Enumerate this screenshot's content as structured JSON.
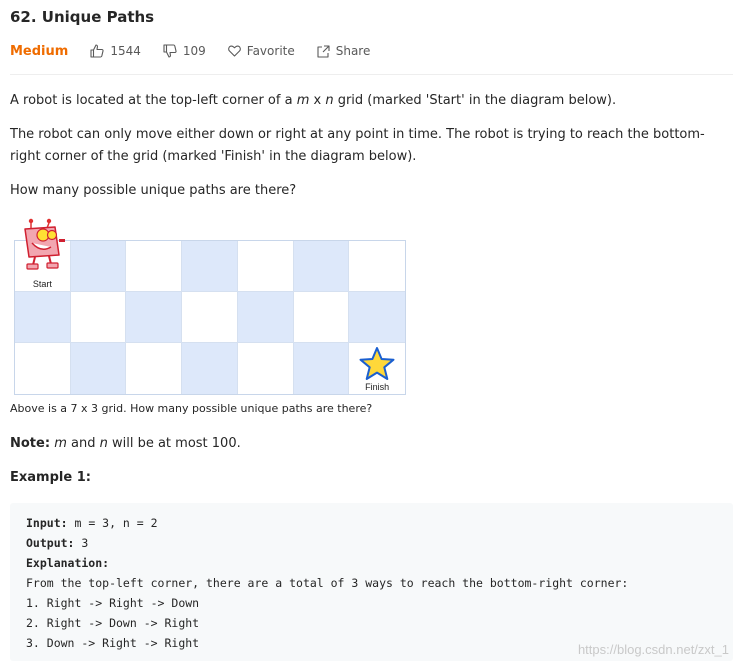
{
  "problem": {
    "title": "62. Unique Paths",
    "difficulty": "Medium",
    "likes": "1544",
    "dislikes": "109",
    "favorite_label": "Favorite",
    "share_label": "Share"
  },
  "description": {
    "p1_before": "A robot is located at the top-left corner of a ",
    "p1_m": "m",
    "p1_x": " x ",
    "p1_n": "n",
    "p1_after": " grid (marked 'Start' in the diagram below).",
    "p2": "The robot can only move either down or right at any point in time. The robot is trying to reach the bottom-right corner of the grid (marked 'Finish' in the diagram below).",
    "p3": "How many possible unique paths are there?"
  },
  "diagram": {
    "start_label": "Start",
    "finish_label": "Finish",
    "caption": "Above is a 7 x 3 grid. How many possible unique paths are there?",
    "colors": {
      "light": "#ffffff",
      "shaded": "#dde8fa"
    }
  },
  "note": {
    "label": "Note:",
    "m": "m",
    "and": " and ",
    "n": "n",
    "rest": " will be at most 100."
  },
  "example": {
    "heading": "Example 1:",
    "input_label": "Input:",
    "input_value": " m = 3, n = 2",
    "output_label": "Output:",
    "output_value": " 3",
    "explanation_label": "Explanation:",
    "lines": [
      "From the top-left corner, there are a total of 3 ways to reach the bottom-right corner:",
      "1. Right -> Right -> Down",
      "2. Right -> Down -> Right",
      "3. Down -> Right -> Right"
    ]
  },
  "watermark": "https://blog.csdn.net/zxt_1"
}
